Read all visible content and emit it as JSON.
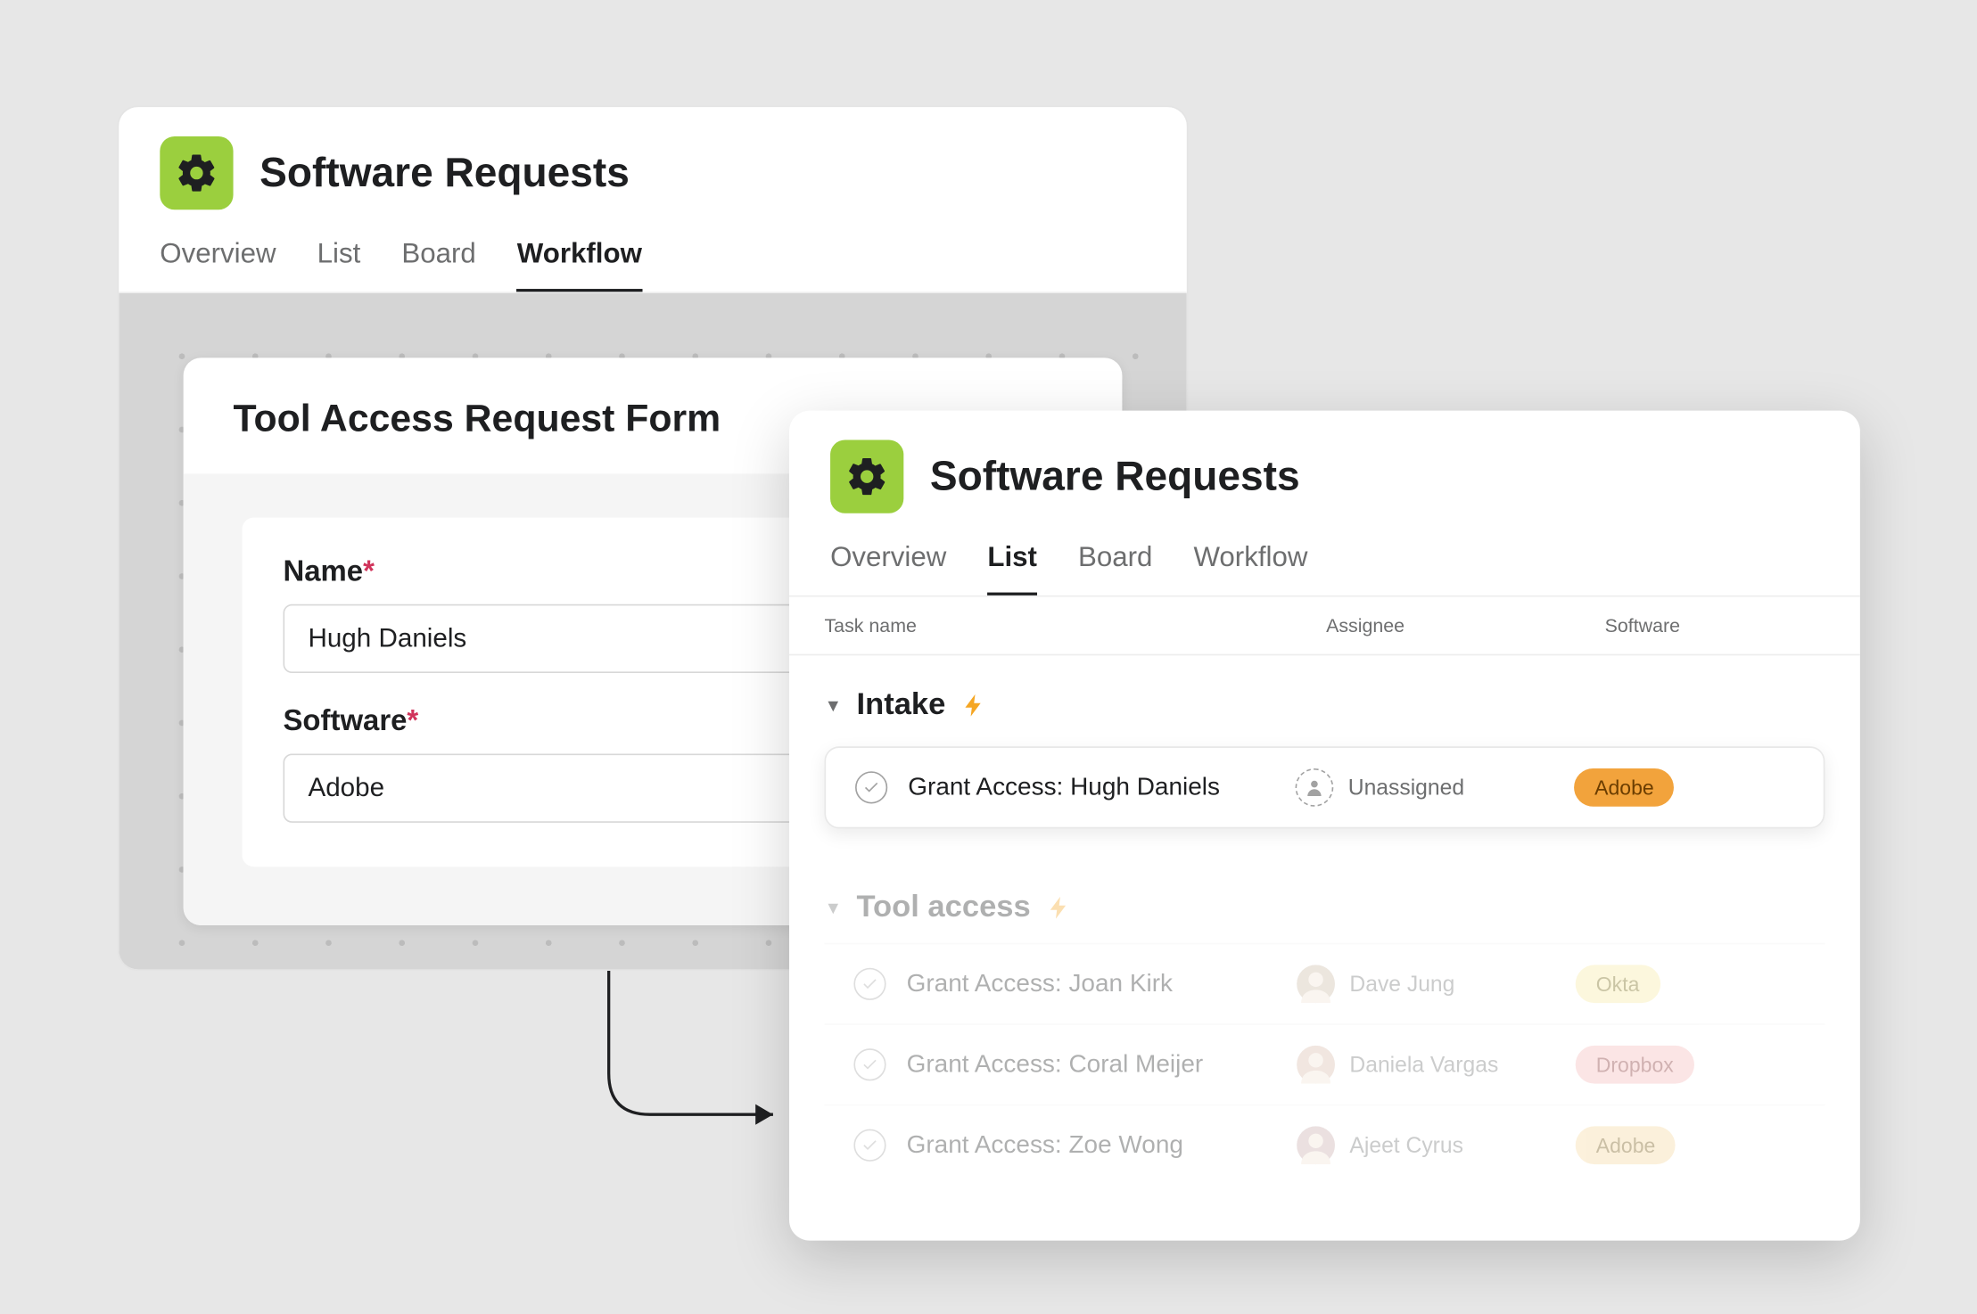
{
  "workflow_card": {
    "title": "Software Requests",
    "tabs": [
      "Overview",
      "List",
      "Board",
      "Workflow"
    ],
    "active_tab": "Workflow",
    "form": {
      "title": "Tool Access Request Form",
      "fields": [
        {
          "label": "Name",
          "required": true,
          "value": "Hugh Daniels"
        },
        {
          "label": "Software",
          "required": true,
          "value": "Adobe"
        }
      ]
    }
  },
  "list_card": {
    "title": "Software Requests",
    "tabs": [
      "Overview",
      "List",
      "Board",
      "Workflow"
    ],
    "active_tab": "List",
    "columns": [
      "Task name",
      "Assignee",
      "Software"
    ],
    "sections": [
      {
        "name": "Intake",
        "has_rule": true,
        "faded": false,
        "rows": [
          {
            "task": "Grant Access: Hugh Daniels",
            "assignee": "Unassigned",
            "assignee_type": "unassigned",
            "software": "Adobe",
            "pill_bg": "#f2a33c",
            "pill_fg": "#6b3d00",
            "highlighted": true
          }
        ]
      },
      {
        "name": "Tool access",
        "has_rule": true,
        "faded": true,
        "rows": [
          {
            "task": "Grant Access: Joan Kirk",
            "assignee": "Dave Jung",
            "assignee_type": "photo",
            "avatar_bg": "#c9b8a3",
            "software": "Okta",
            "pill_bg": "#f7eaa0",
            "pill_fg": "#6b5b00",
            "highlighted": false
          },
          {
            "task": "Grant Access: Coral Meijer",
            "assignee": "Daniela Vargas",
            "assignee_type": "photo",
            "avatar_bg": "#d8b9a8",
            "software": "Dropbox",
            "pill_bg": "#f4b6b6",
            "pill_fg": "#7a2323",
            "highlighted": false
          },
          {
            "task": "Grant Access: Zoe Wong",
            "assignee": "Ajeet Cyrus",
            "assignee_type": "photo",
            "avatar_bg": "#c7a9a9",
            "software": "Adobe",
            "pill_bg": "#f6d79a",
            "pill_fg": "#6b4a00",
            "highlighted": false
          }
        ]
      }
    ]
  }
}
